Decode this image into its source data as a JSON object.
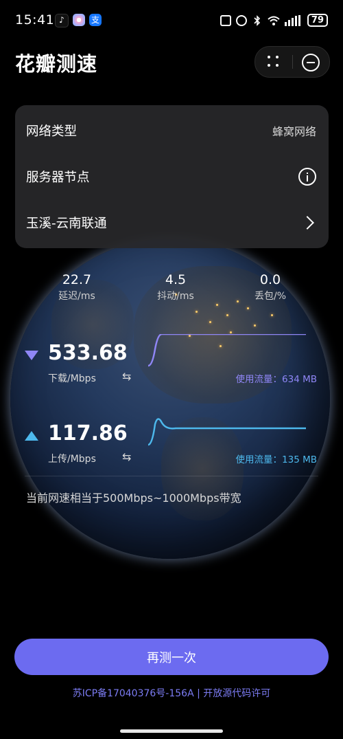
{
  "status_bar": {
    "time": "15:41",
    "battery": "79"
  },
  "app_title": "花瓣测速",
  "card": {
    "network_type_label": "网络类型",
    "network_type_value": "蜂窝网络",
    "server_node_label": "服务器节点",
    "server_name": "玉溪-云南联通"
  },
  "metrics": {
    "latency": {
      "value": "22.7",
      "unit": "延迟/ms"
    },
    "jitter": {
      "value": "4.5",
      "unit": "抖动/ms"
    },
    "loss": {
      "value": "0.0",
      "unit": "丢包/%"
    }
  },
  "download": {
    "value": "533.68",
    "unit": "下载/Mbps",
    "usage": "使用流量：634 MB",
    "color": "#8f86f5"
  },
  "upload": {
    "value": "117.86",
    "unit": "上传/Mbps",
    "usage": "使用流量：135 MB",
    "color": "#4db8ec"
  },
  "equivalent_text": "当前网速相当于500Mbps~1000Mbps带宽",
  "retest_label": "再测一次",
  "footer_text": "苏ICP备17040376号-156A | 开放源代码许可",
  "icons": [
    "tiktok-icon",
    "browser-icon",
    "alipay-icon",
    "nfc-icon",
    "alarm-icon",
    "bluetooth-icon",
    "wifi-icon",
    "signal-icon",
    "battery-icon",
    "dots-icon",
    "minus-circle-icon",
    "info-icon",
    "chevron-right-icon",
    "swap-icon"
  ]
}
